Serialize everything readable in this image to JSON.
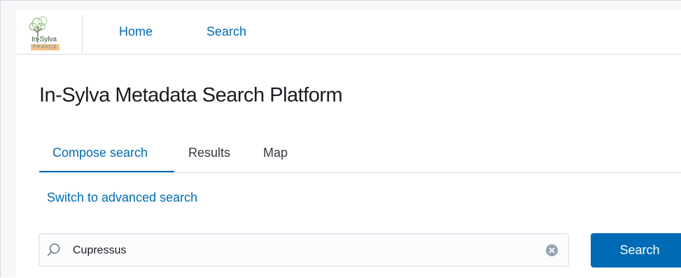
{
  "navbar": {
    "logo_text": "In-Sylva",
    "logo_subtext": "FRANCE",
    "links": [
      {
        "label": "Home"
      },
      {
        "label": "Search"
      }
    ]
  },
  "main": {
    "title": "In-Sylva Metadata Search Platform",
    "tabs": [
      {
        "label": "Compose search",
        "active": true
      },
      {
        "label": "Results",
        "active": false
      },
      {
        "label": "Map",
        "active": false
      }
    ],
    "advanced_link": "Switch to advanced search",
    "search": {
      "value": "Cupressus",
      "icon": "search-icon",
      "clear_icon": "clear-icon",
      "button_label": "Search"
    }
  },
  "colors": {
    "accent": "#006bb4",
    "text": "#1a1c21",
    "border": "#d3dae6"
  }
}
